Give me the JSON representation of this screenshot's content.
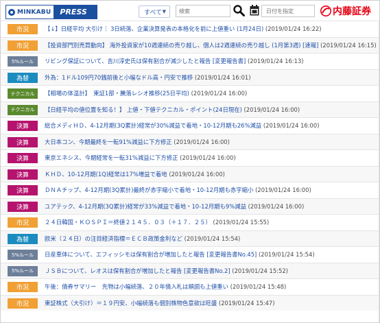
{
  "header": {
    "logo_left": "MINKABU",
    "logo_right": "PRESS",
    "select_value": "すべて",
    "search_placeholder": "検索",
    "date_placeholder": "日付を指定",
    "brand": "内藤証券",
    "brand_color": "#e60012"
  },
  "badge_colors": {
    "市況": "#f0a035",
    "5%ルール": "#6d7f99",
    "為替": "#1c8cc0",
    "テクニカル": "#5b8a2e",
    "決算": "#b5136e"
  },
  "items": [
    {
      "category": "市況",
      "title": "【↓】日経平均 大引け｜ 3日続落、企業決算発表の本格化を前に上値重い (1月24日)",
      "time": "2019/01/24 16:22"
    },
    {
      "category": "市況",
      "title": "【投資部門別売買動向】 海外投資家が10週連続の売り越し、個人は2週連続の売り越し (1月第3週) [速報]",
      "time": "2019/01/24 16:15"
    },
    {
      "category": "5%ルール",
      "title": "リビング保証について、吉川淳史氏は保有割合が減少したと報告 [変更報告書]",
      "time": "2019/01/24 16:13"
    },
    {
      "category": "為替",
      "title": "外為：1ドル109円70銭前後と小幅なドル高・円安で推移",
      "time": "2019/01/24 16:01"
    },
    {
      "category": "テクニカル",
      "title": "【相場の体温計】　東証1部・騰落レシオ推移(25日平均)",
      "time": "2019/01/24 16:00"
    },
    {
      "category": "テクニカル",
      "title": "【日経平均の値位置を知る！】 上値・下値テクニカル・ポイント(24日現在)",
      "time": "2019/01/24 16:00"
    },
    {
      "category": "決算",
      "title": "総合メディＨＤ、4-12月期(3Q累計)経常が30%減益で着地・10-12月期も26%減益",
      "time": "2019/01/24 16:00"
    },
    {
      "category": "決算",
      "title": "大日本コン、今期最終を一転91%減益に下方修正",
      "time": "2019/01/24 16:00"
    },
    {
      "category": "決算",
      "title": "東京エネシス、今期経常を一転31%減益に下方修正",
      "time": "2019/01/24 16:00"
    },
    {
      "category": "決算",
      "title": "ＫＨＤ、10-12月期(1Q)経常は17%増益で着地",
      "time": "2019/01/24 16:00"
    },
    {
      "category": "決算",
      "title": "ＤＮＡチップ、4-12月期(3Q累計)最終が赤字縮小で着地・10-12月期も赤字縮小",
      "time": "2019/01/24 16:00"
    },
    {
      "category": "決算",
      "title": "ユアテック、4-12月期(3Q累計)経常が33%減益で着地・10-12月期も9%減益",
      "time": "2019/01/24 16:00"
    },
    {
      "category": "市況",
      "title": "２４日韓国・ＫＯＳＰＩ＝終値２１４５．０３（＋１７．２５）",
      "time": "2019/01/24 15:55"
    },
    {
      "category": "為替",
      "title": "欧米（２４日）の注目経済指標＝ＥＣＢ政策金利など",
      "time": "2019/01/24 15:54"
    },
    {
      "category": "5%ルール",
      "title": "日産車体について、エフィッシモは保有割合が増加したと報告 [変更報告書No.45]",
      "time": "2019/01/24 15:54"
    },
    {
      "category": "5%ルール",
      "title": "ＪＳＢについて、レオスは保有割合が増加したと報告 [変更報告書No.2]",
      "time": "2019/01/24 15:52"
    },
    {
      "category": "市況",
      "title": "午後：債券サマリー　先物は小幅続落、２０年債入札は順調も上値重い",
      "time": "2019/01/24 15:48"
    },
    {
      "category": "市況",
      "title": "東証株式（大引け）＝１９円安、小幅続落も個別株物色意欲は旺盛",
      "time": "2019/01/24 15:47"
    }
  ]
}
